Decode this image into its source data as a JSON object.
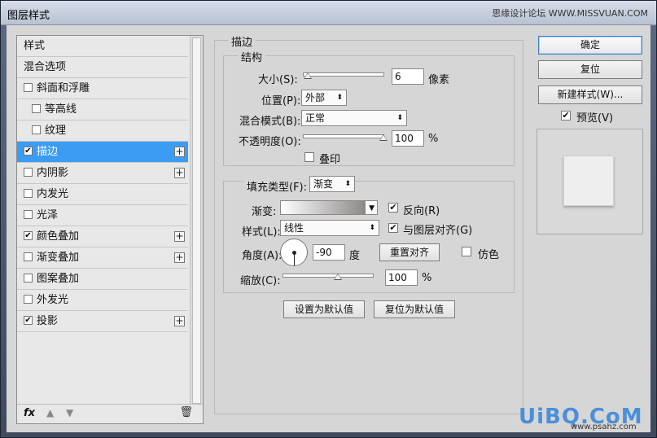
{
  "window": {
    "title": "图层样式",
    "watermark_top": "思缘设计论坛 WWW.MISSVUAN.COM"
  },
  "stylelist": {
    "items": [
      {
        "label": "样式",
        "checkbox": false,
        "checked": false,
        "plus": false,
        "selected": false
      },
      {
        "label": "混合选项",
        "checkbox": false,
        "checked": false,
        "plus": false,
        "selected": false
      },
      {
        "label": "斜面和浮雕",
        "checkbox": true,
        "checked": false,
        "plus": false,
        "selected": false
      },
      {
        "label": "等高线",
        "checkbox": true,
        "checked": false,
        "plus": false,
        "selected": false,
        "sub": true
      },
      {
        "label": "纹理",
        "checkbox": true,
        "checked": false,
        "plus": false,
        "selected": false,
        "sub": true
      },
      {
        "label": "描边",
        "checkbox": true,
        "checked": true,
        "plus": true,
        "selected": true
      },
      {
        "label": "内阴影",
        "checkbox": true,
        "checked": false,
        "plus": true,
        "selected": false
      },
      {
        "label": "内发光",
        "checkbox": true,
        "checked": false,
        "plus": false,
        "selected": false
      },
      {
        "label": "光泽",
        "checkbox": true,
        "checked": false,
        "plus": false,
        "selected": false
      },
      {
        "label": "颜色叠加",
        "checkbox": true,
        "checked": true,
        "plus": true,
        "selected": false
      },
      {
        "label": "渐变叠加",
        "checkbox": true,
        "checked": false,
        "plus": true,
        "selected": false
      },
      {
        "label": "图案叠加",
        "checkbox": true,
        "checked": false,
        "plus": false,
        "selected": false
      },
      {
        "label": "外发光",
        "checkbox": true,
        "checked": false,
        "plus": false,
        "selected": false
      },
      {
        "label": "投影",
        "checkbox": true,
        "checked": true,
        "plus": true,
        "selected": false
      }
    ],
    "footer_fx": "fx"
  },
  "stroke": {
    "group_title": "描边",
    "structure_title": "结构",
    "size_label": "大小(S):",
    "size_value": "6",
    "size_unit": "像素",
    "position_label": "位置(P):",
    "position_value": "外部",
    "blend_label": "混合模式(B):",
    "blend_value": "正常",
    "opacity_label": "不透明度(O):",
    "opacity_value": "100",
    "opacity_unit": "%",
    "overprint_label": "叠印"
  },
  "fill": {
    "fill_type_label": "填充类型(F):",
    "fill_type_value": "渐变",
    "gradient_label": "渐变:",
    "reverse_label": "反向(R)",
    "style_label": "样式(L):",
    "style_value": "线性",
    "align_label": "与图层对齐(G)",
    "angle_label": "角度(A):",
    "angle_value": "-90",
    "angle_unit": "度",
    "reset_align_label": "重置对齐",
    "dither_label": "仿色",
    "scale_label": "缩放(C):",
    "scale_value": "100",
    "scale_unit": "%"
  },
  "bottom_buttons": {
    "set_default": "设置为默认值",
    "reset_default": "复位为默认值"
  },
  "right_panel": {
    "ok": "确定",
    "reset": "复位",
    "new_style": "新建样式(W)...",
    "preview_label": "预览(V)"
  },
  "watermark": {
    "logo": "UiBQ.CoM",
    "sub": "www.psahz.com"
  }
}
